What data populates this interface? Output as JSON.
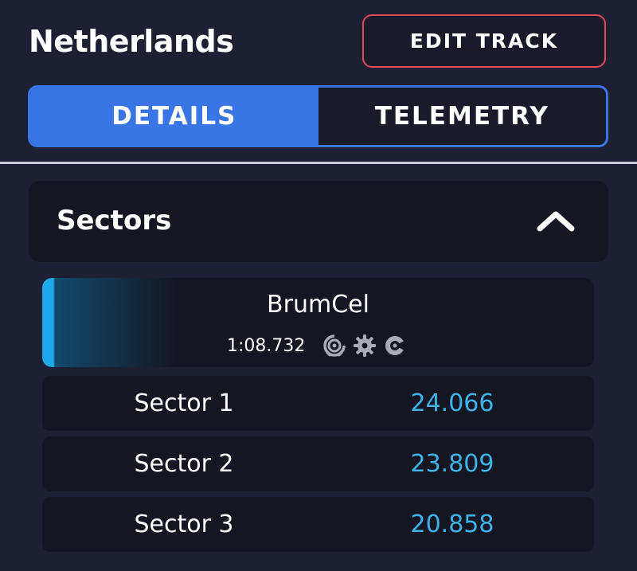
{
  "header": {
    "title": "Netherlands",
    "edit_button_label": "EDIT TRACK"
  },
  "tabs": [
    {
      "label": "DETAILS",
      "active": true
    },
    {
      "label": "TELEMETRY",
      "active": false
    }
  ],
  "sectors_panel": {
    "title": "Sectors",
    "expanded": true,
    "toggle_icon": "chevron-up-icon"
  },
  "driver": {
    "name": "BrumCel",
    "lap_time": "1:08.732",
    "assist_icons": [
      "traction-control-icon",
      "gearbox-icon",
      "abs-icon"
    ],
    "accent_color": "#1ea7ea"
  },
  "sectors": [
    {
      "label": "Sector 1",
      "time": "24.066"
    },
    {
      "label": "Sector 2",
      "time": "23.809"
    },
    {
      "label": "Sector 3",
      "time": "20.858"
    }
  ],
  "colors": {
    "background": "#1d2032",
    "card": "#141622",
    "tab_active": "#3a75e6",
    "edit_border": "#e24a58",
    "sector_time": "#3db3ea",
    "icon_gray": "#a9abb6"
  }
}
